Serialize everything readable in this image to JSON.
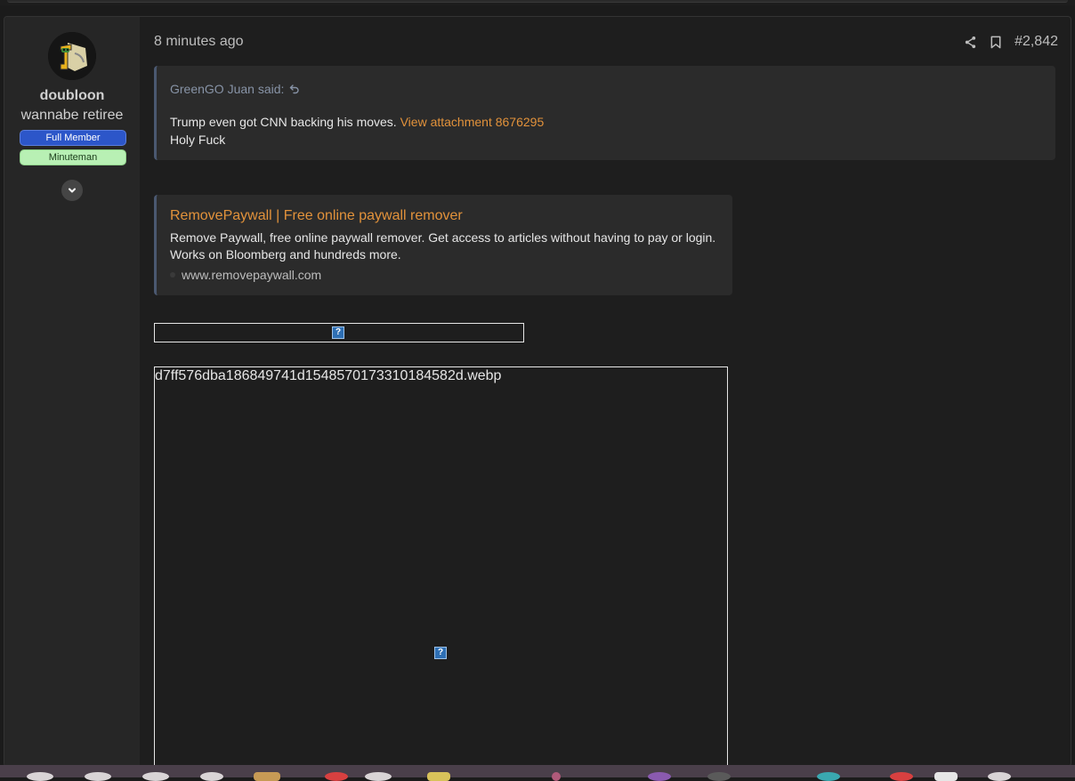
{
  "post": {
    "time": "8 minutes ago",
    "post_number": "#2,842",
    "share_icon": "share-icon",
    "bookmark_icon": "bookmark-icon"
  },
  "user": {
    "name": "doubloon",
    "title": "wannabe retiree",
    "banners": [
      "Full Member",
      "Minuteman"
    ],
    "expand_icon": "chevron-down-icon"
  },
  "quote": {
    "author": "GreenGO Juan said:",
    "jump_icon": "reply-arrow-icon",
    "text": "Trump even got CNN backing his moves.",
    "attachment_link": "View attachment 8676295",
    "reply": "Holy Fuck"
  },
  "unfurl": {
    "title": "RemovePaywall | Free online paywall remover",
    "description": "Remove Paywall, free online paywall remover. Get access to articles without having to pay or login. Works on Bloomberg and hundreds more.",
    "domain": "www.removepaywall.com"
  },
  "images": {
    "broken_icon_glyph": "?",
    "large_alt": "d7ff576dba186849741d1548570173310184582d.webp"
  },
  "colors": {
    "accent_link": "#e2923b",
    "full_member_banner": "#2c56c9",
    "minuteman_banner": "#b8f0b4"
  }
}
